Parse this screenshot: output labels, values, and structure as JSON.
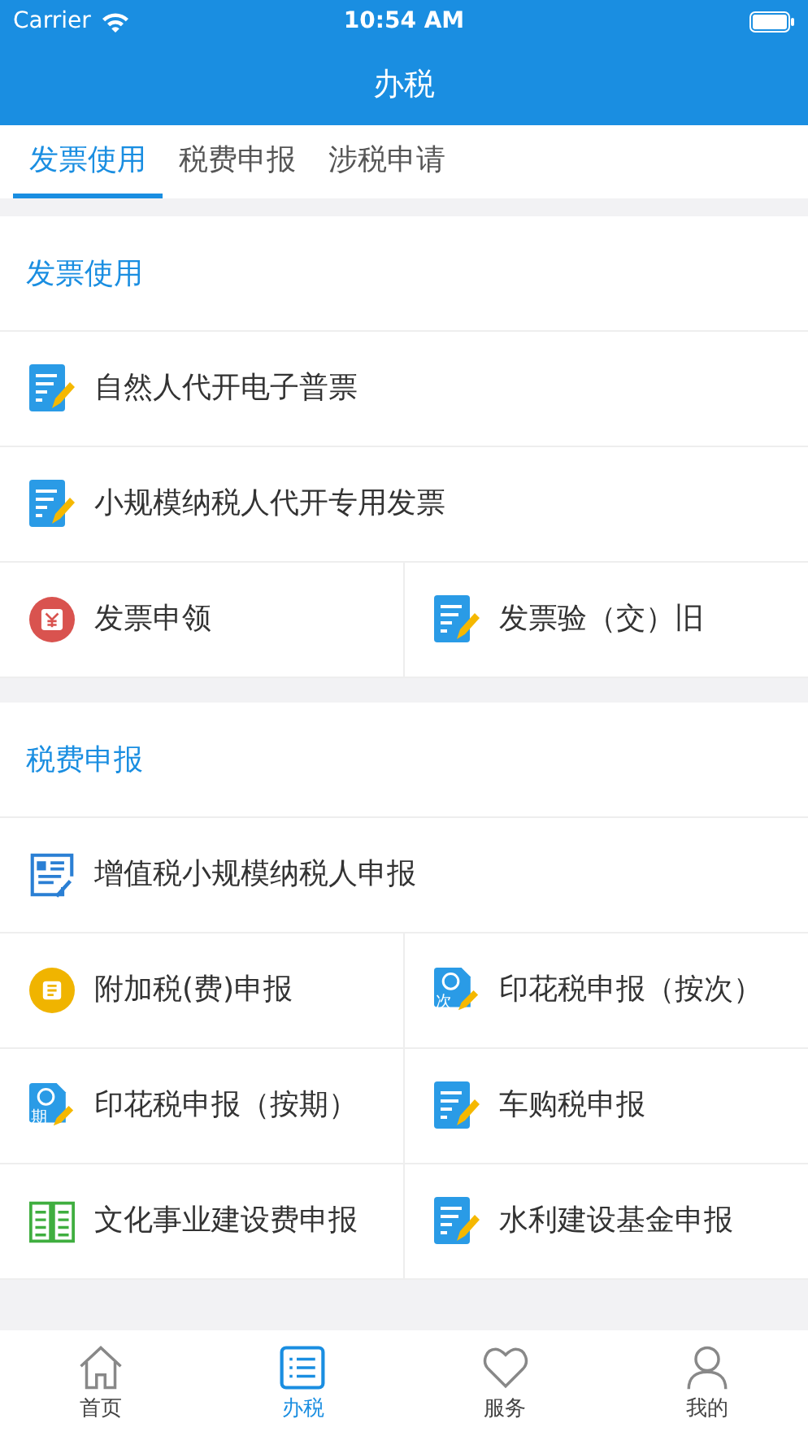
{
  "status_bar": {
    "carrier": "Carrier",
    "time": "10:54 AM"
  },
  "nav_bar": {
    "title": "办税"
  },
  "tabs": [
    {
      "label": "发票使用",
      "selected": true
    },
    {
      "label": "税费申报",
      "selected": false
    },
    {
      "label": "涉税申请",
      "selected": false
    }
  ],
  "sections": [
    {
      "title": "发票使用",
      "rows": [
        [
          {
            "label": "自然人代开电子普票",
            "kind": "note"
          }
        ],
        [
          {
            "label": "小规模纳税人代开专用发票",
            "kind": "note"
          }
        ],
        [
          {
            "label": "发票申领",
            "kind": "yen"
          },
          {
            "label": "发票验（交）旧",
            "kind": "note"
          }
        ]
      ]
    },
    {
      "title": "税费申报",
      "rows": [
        [
          {
            "label": "增值税小规模纳税人申报",
            "kind": "report"
          }
        ],
        [
          {
            "label": "附加税(费)申报",
            "kind": "coin"
          },
          {
            "label": "印花税申报（按次）",
            "kind": "stamp",
            "icon_label": "次"
          }
        ],
        [
          {
            "label": "印花税申报（按期）",
            "kind": "stamp",
            "icon_label": "期"
          },
          {
            "label": "车购税申报",
            "kind": "note"
          }
        ],
        [
          {
            "label": "文化事业建设费申报",
            "kind": "book"
          },
          {
            "label": "水利建设基金申报",
            "kind": "note"
          }
        ]
      ]
    }
  ],
  "tab_bar": [
    {
      "label": "首页",
      "kind": "home",
      "selected": false
    },
    {
      "label": "办税",
      "kind": "list",
      "selected": true
    },
    {
      "label": "服务",
      "kind": "heart",
      "selected": false
    },
    {
      "label": "我的",
      "kind": "person",
      "selected": false
    }
  ]
}
